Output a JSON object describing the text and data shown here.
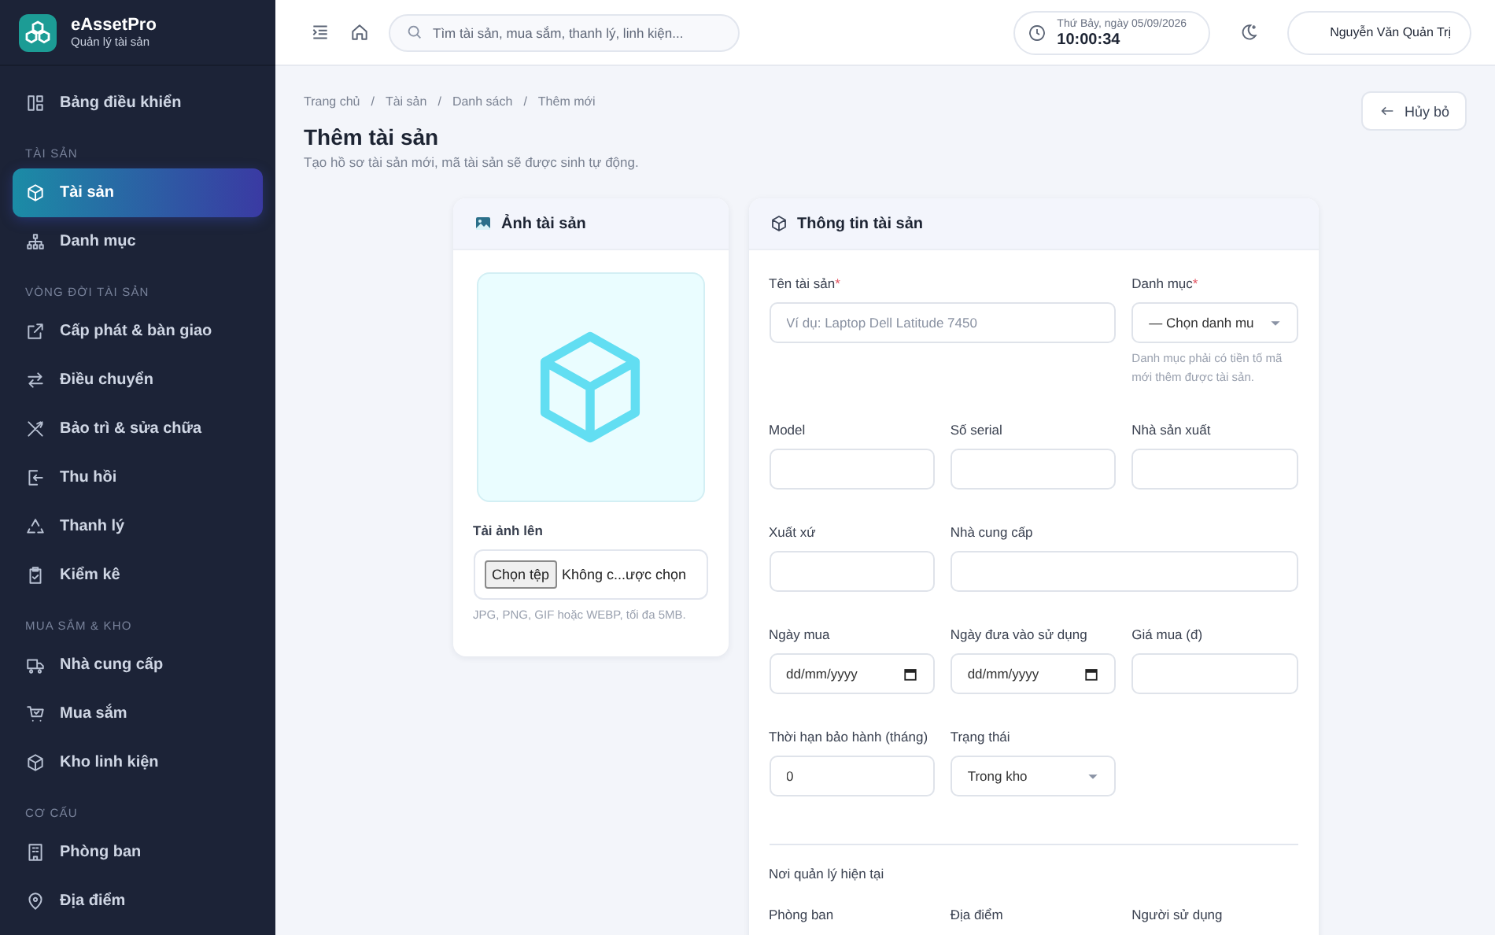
{
  "brand": {
    "name": "eAssetPro",
    "tagline": "Quản lý tài sản"
  },
  "sidebar": {
    "groups": [
      {
        "items": [
          {
            "label": "Bảng điều khiển",
            "selected": false
          }
        ]
      },
      {
        "heading": "TÀI SẢN",
        "items": [
          {
            "label": "Tài sản",
            "selected": true
          },
          {
            "label": "Danh mục",
            "selected": false
          }
        ]
      },
      {
        "heading": "VÒNG ĐỜI TÀI SẢN",
        "items": [
          {
            "label": "Cấp phát & bàn giao",
            "selected": false
          },
          {
            "label": "Điều chuyển",
            "selected": false
          },
          {
            "label": "Bảo trì & sửa chữa",
            "selected": false
          },
          {
            "label": "Thu hồi",
            "selected": false
          },
          {
            "label": "Thanh lý",
            "selected": false
          },
          {
            "label": "Kiểm kê",
            "selected": false
          }
        ]
      },
      {
        "heading": "MUA SẮM & KHO",
        "items": [
          {
            "label": "Nhà cung cấp",
            "selected": false
          },
          {
            "label": "Mua sắm",
            "selected": false
          },
          {
            "label": "Kho linh kiện",
            "selected": false
          }
        ]
      },
      {
        "heading": "CƠ CẤU",
        "items": [
          {
            "label": "Phòng ban",
            "selected": false
          },
          {
            "label": "Địa điểm",
            "selected": false
          }
        ]
      }
    ]
  },
  "topbar": {
    "search": {
      "placeholder": "Tìm tài sản, mua sắm, thanh lý, linh kiện..."
    },
    "clock": {
      "date": "Thứ Bảy, ngày 05/09/2026",
      "time": "10:00:34"
    },
    "user": {
      "name": "Nguyễn Văn Quản Trị"
    }
  },
  "breadcrumb": {
    "separator": "/",
    "items": [
      "Trang chủ",
      "Tài sản",
      "Danh sách",
      "Thêm mới"
    ]
  },
  "title": "Thêm tài sản",
  "subtitle": "Tạo hồ sơ tài sản mới, mã tài sản sẽ được sinh tự động.",
  "cancel_button": "Hủy bỏ",
  "photo_card": {
    "title": "Ảnh tài sản",
    "upload_label": "Tải ảnh lên",
    "file_button": "Chọn tệp",
    "file_status": "Không c...ược chọn",
    "hint": "JPG, PNG, GIF hoặc WEBP, tối đa 5MB."
  },
  "info_card": {
    "title": "Thông tin tài sản",
    "rows": [
      [
        {
          "label": "Tên tài sản",
          "required_mark": "*",
          "kind": "text",
          "placeholder": "Ví dụ: Laptop Dell Latitude 7450",
          "colspan": 2
        },
        {
          "label": "Danh mục",
          "required_mark": "*",
          "kind": "select",
          "value": "— Chọn danh mu",
          "hint": "Danh mục phải có tiền tố mã mới thêm được tài sản."
        }
      ],
      [
        {
          "label": "Model",
          "kind": "text"
        },
        {
          "label": "Số serial",
          "kind": "text"
        },
        {
          "label": "Nhà sản xuất",
          "kind": "text"
        }
      ],
      [
        {
          "label": "Xuất xứ",
          "kind": "text"
        },
        {
          "label": "Nhà cung cấp",
          "kind": "text",
          "colspan": 2
        }
      ],
      [
        {
          "label": "Ngày mua",
          "kind": "date",
          "value": "dd/mm/yyyy"
        },
        {
          "label": "Ngày đưa vào sử dụng",
          "kind": "date",
          "value": "dd/mm/yyyy"
        },
        {
          "label": "Giá mua (đ)",
          "kind": "text"
        }
      ],
      [
        {
          "label": "Thời hạn bảo hành (tháng)",
          "kind": "text",
          "value": "0"
        },
        {
          "label": "Trạng thái",
          "kind": "select",
          "value": "Trong kho"
        }
      ]
    ],
    "section_title": "Nơi quản lý hiện tại",
    "section_labels": [
      "Phòng ban",
      "Địa điểm",
      "Người sử dụng"
    ]
  }
}
